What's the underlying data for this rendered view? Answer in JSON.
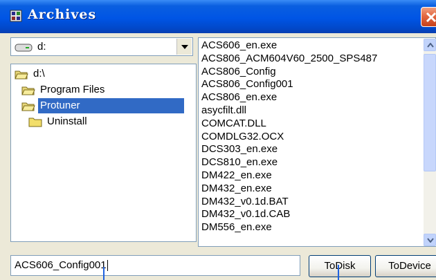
{
  "window": {
    "title": "Archives",
    "icon": "app-icon"
  },
  "drive": {
    "label": "d:",
    "icon": "drive-icon"
  },
  "tree": [
    {
      "label": "d:\\",
      "level": 0,
      "selected": false,
      "icon": "open-folder-icon"
    },
    {
      "label": "Program Files",
      "level": 1,
      "selected": false,
      "icon": "open-folder-icon"
    },
    {
      "label": "Protuner",
      "level": 1,
      "selected": true,
      "icon": "open-folder-icon"
    },
    {
      "label": "Uninstall",
      "level": 2,
      "selected": false,
      "icon": "folder-icon"
    }
  ],
  "files": [
    "ACS606_en.exe",
    "ACS806_ACM604V60_2500_SPS487",
    "ACS806_Config",
    "ACS806_Config001",
    "ACS806_en.exe",
    "asycfilt.dll",
    "COMCAT.DLL",
    "COMDLG32.OCX",
    "DCS303_en.exe",
    "DCS810_en.exe",
    "DM422_en.exe",
    "DM432_en.exe",
    "DM432_v0.1d.BAT",
    "DM432_v0.1d.CAB",
    "DM556_en.exe"
  ],
  "filename_input": {
    "value": "ACS606_Config001"
  },
  "buttons": {
    "todisk": "ToDisk",
    "todevice": "ToDevice"
  },
  "colors": {
    "title_bar": "#0055e5",
    "selection": "#316ac5",
    "close_button": "#e26841",
    "window_bg": "#ece9d8"
  }
}
